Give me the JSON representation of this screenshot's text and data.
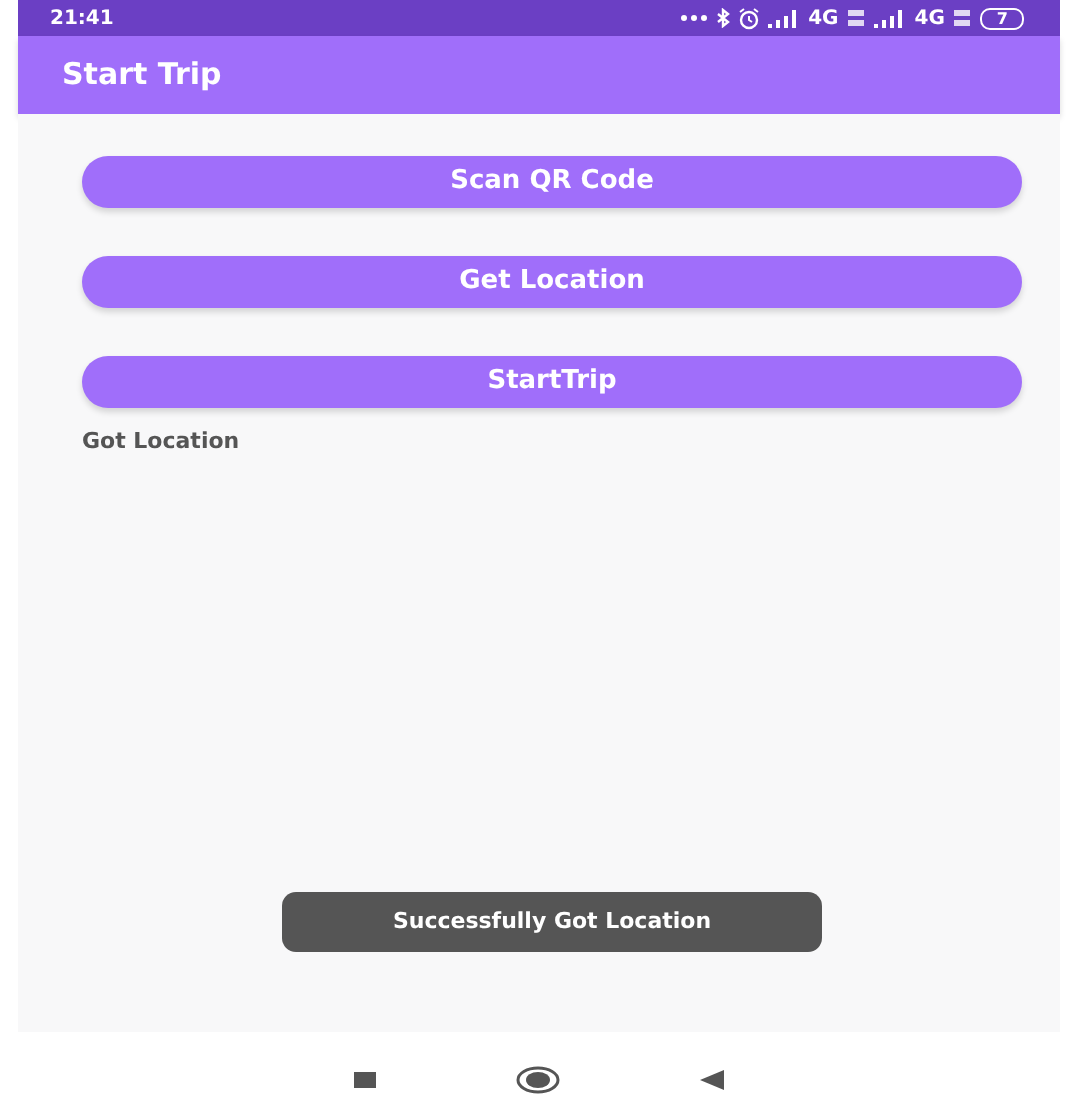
{
  "status_bar": {
    "time": "21:41",
    "network_1": "4G",
    "network_2": "4G",
    "battery": "7"
  },
  "app_bar": {
    "title": "Start Trip"
  },
  "buttons": [
    {
      "label": "Scan QR Code"
    },
    {
      "label": "Get Location"
    },
    {
      "label": "StartTrip"
    }
  ],
  "status_text": "Got Location",
  "toast": "Successfully Got Location"
}
